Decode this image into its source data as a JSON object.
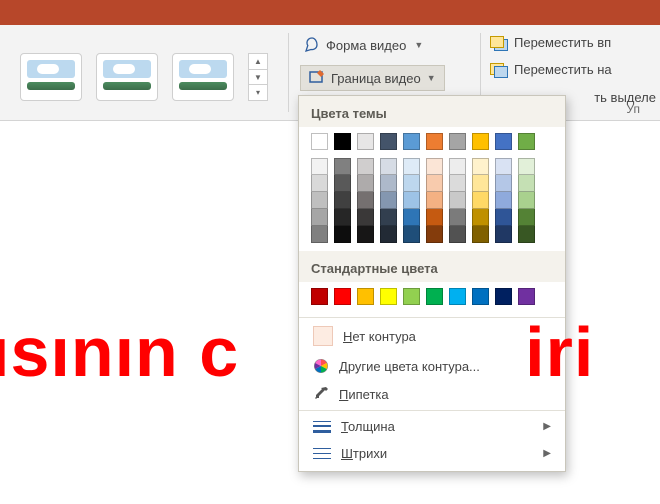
{
  "ribbon": {
    "video_shape_label": "Форма видео",
    "video_border_label": "Граница видео",
    "bring_forward_label": "Переместить вп",
    "send_backward_label": "Переместить на",
    "selection_pane_label": "ть выделе",
    "group_caption": "Уп"
  },
  "border_menu": {
    "theme_colors_title": "Цвета темы",
    "theme_top_row": [
      "#ffffff",
      "#000000",
      "#e7e6e6",
      "#44546a",
      "#5b9bd5",
      "#ed7d31",
      "#a5a5a5",
      "#ffc000",
      "#4472c4",
      "#70ad47"
    ],
    "theme_shades": [
      [
        "#f2f2f2",
        "#d9d9d9",
        "#bfbfbf",
        "#a6a6a6",
        "#808080"
      ],
      [
        "#808080",
        "#595959",
        "#404040",
        "#262626",
        "#0d0d0d"
      ],
      [
        "#d0cece",
        "#aeabab",
        "#757070",
        "#3a3838",
        "#171616"
      ],
      [
        "#d6dce5",
        "#adb9ca",
        "#8497b0",
        "#323f4f",
        "#222a35"
      ],
      [
        "#deebf7",
        "#bdd7ee",
        "#9dc3e6",
        "#2e75b6",
        "#1f4e79"
      ],
      [
        "#fbe5d6",
        "#f8cbad",
        "#f4b183",
        "#c55a11",
        "#843c0c"
      ],
      [
        "#ededed",
        "#dbdbdb",
        "#c9c9c9",
        "#7b7b7b",
        "#525252"
      ],
      [
        "#fff2cc",
        "#ffe699",
        "#ffd966",
        "#bf9000",
        "#806000"
      ],
      [
        "#d9e2f3",
        "#b4c7e7",
        "#8faadc",
        "#2f5597",
        "#203864"
      ],
      [
        "#e2f0d9",
        "#c5e0b4",
        "#a9d18e",
        "#548235",
        "#385723"
      ]
    ],
    "standard_colors_title": "Стандартные цвета",
    "standard_colors": [
      "#c00000",
      "#ff0000",
      "#ffc000",
      "#ffff00",
      "#92d050",
      "#00b050",
      "#00b0f0",
      "#0070c0",
      "#002060",
      "#7030a0"
    ],
    "no_outline_label": "Нет контура",
    "more_colors_label": "Другие цвета контура...",
    "eyedropper_label": "Пипетка",
    "weight_label": "Толщина",
    "dashes_label": "Штрихи"
  },
  "slide": {
    "red_text_left": "ısının c",
    "red_text_right": "iri"
  }
}
